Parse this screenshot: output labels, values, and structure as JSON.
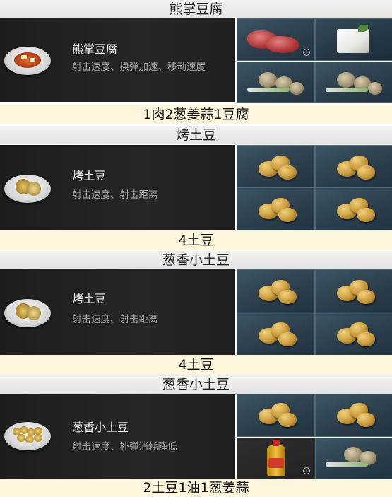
{
  "sections": [
    {
      "header": "熊掌豆腐",
      "dish_name": "熊掌豆腐",
      "dish_effect": "射击速度、换弹加速、移动速度",
      "ingredients": [
        "meat-icon",
        "tofu-icon",
        "onion-ginger-garlic-icon",
        "onion-ginger-garlic-icon"
      ],
      "recipe": "1肉2葱姜蒜1豆腐"
    },
    {
      "header": "烤土豆",
      "dish_name": "烤土豆",
      "dish_effect": "射击速度、射击距离",
      "ingredients": [
        "potato-icon",
        "potato-icon",
        "potato-icon",
        "potato-icon"
      ],
      "recipe": "4土豆"
    },
    {
      "header": "葱香小土豆",
      "dish_name": "烤土豆",
      "dish_effect": "射击速度、射击距离",
      "ingredients": [
        "potato-icon",
        "potato-icon",
        "potato-icon",
        "potato-icon"
      ],
      "recipe": "4土豆"
    },
    {
      "header": "葱香小土豆",
      "dish_name": "葱香小土豆",
      "dish_effect": "射击速度、补弹消耗降低",
      "ingredients": [
        "potato-icon",
        "potato-icon",
        "oil-bottle-icon",
        "onion-ginger-garlic-icon"
      ],
      "recipe": "2土豆1油1葱姜蒜"
    }
  ]
}
